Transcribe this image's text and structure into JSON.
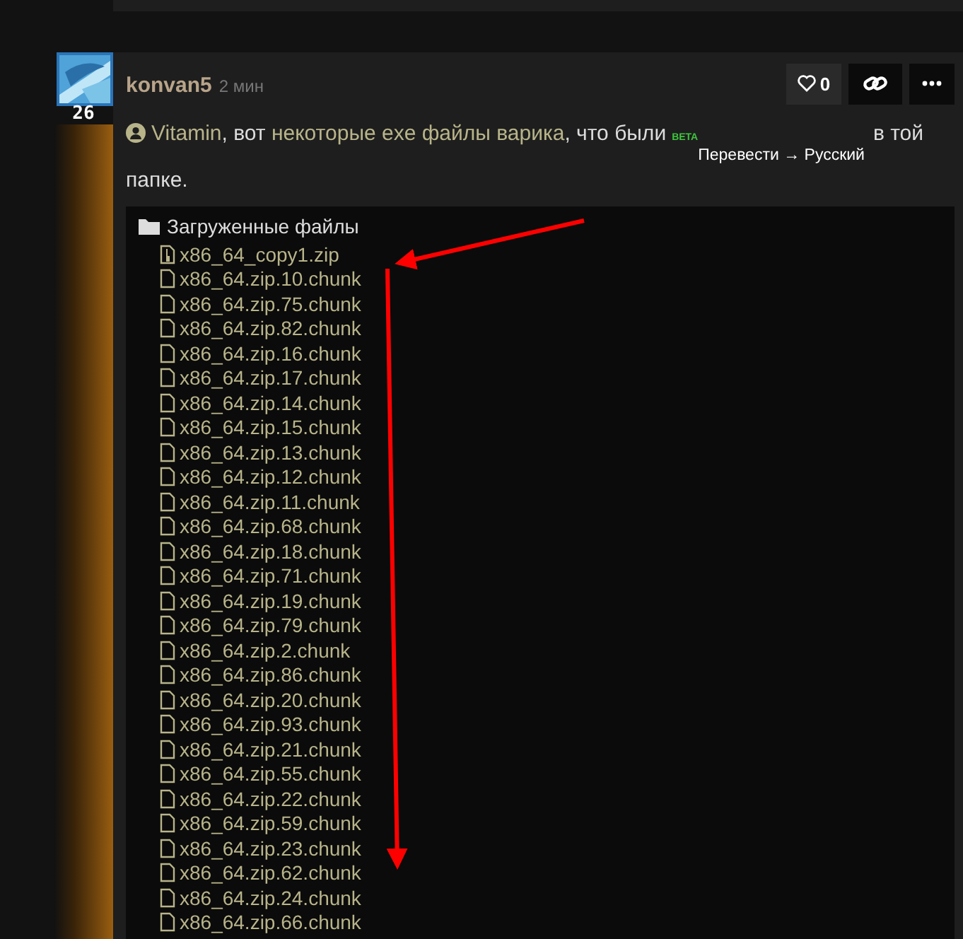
{
  "post": {
    "username": "konvan5",
    "time": "2 мин",
    "post_count": "26",
    "actions": [
      {
        "kind": "like",
        "label": "0"
      },
      {
        "kind": "link"
      },
      {
        "kind": "more"
      }
    ],
    "message": [
      {
        "kind": "mention",
        "text": "Vitamin"
      },
      {
        "kind": "text",
        "text": ", вот "
      },
      {
        "kind": "link",
        "text": "некоторые exe файлы варика"
      },
      {
        "kind": "text",
        "text": ", что были"
      },
      {
        "kind": "translate",
        "badge": "BETA",
        "text": "Перевести → Русский"
      },
      {
        "kind": "text",
        "text": "в той папке."
      }
    ],
    "attachments": {
      "title": "Загруженные файлы",
      "files": [
        {
          "kind": "zip",
          "name": "x86_64_copy1.zip"
        },
        {
          "kind": "file",
          "name": "x86_64.zip.10.chunk"
        },
        {
          "kind": "file",
          "name": "x86_64.zip.75.chunk"
        },
        {
          "kind": "file",
          "name": "x86_64.zip.82.chunk"
        },
        {
          "kind": "file",
          "name": "x86_64.zip.16.chunk"
        },
        {
          "kind": "file",
          "name": "x86_64.zip.17.chunk"
        },
        {
          "kind": "file",
          "name": "x86_64.zip.14.chunk"
        },
        {
          "kind": "file",
          "name": "x86_64.zip.15.chunk"
        },
        {
          "kind": "file",
          "name": "x86_64.zip.13.chunk"
        },
        {
          "kind": "file",
          "name": "x86_64.zip.12.chunk"
        },
        {
          "kind": "file",
          "name": "x86_64.zip.11.chunk"
        },
        {
          "kind": "file",
          "name": "x86_64.zip.68.chunk"
        },
        {
          "kind": "file",
          "name": "x86_64.zip.18.chunk"
        },
        {
          "kind": "file",
          "name": "x86_64.zip.71.chunk"
        },
        {
          "kind": "file",
          "name": "x86_64.zip.19.chunk"
        },
        {
          "kind": "file",
          "name": "x86_64.zip.79.chunk"
        },
        {
          "kind": "file",
          "name": "x86_64.zip.2.chunk"
        },
        {
          "kind": "file",
          "name": "x86_64.zip.86.chunk"
        },
        {
          "kind": "file",
          "name": "x86_64.zip.20.chunk"
        },
        {
          "kind": "file",
          "name": "x86_64.zip.93.chunk"
        },
        {
          "kind": "file",
          "name": "x86_64.zip.21.chunk"
        },
        {
          "kind": "file",
          "name": "x86_64.zip.55.chunk"
        },
        {
          "kind": "file",
          "name": "x86_64.zip.22.chunk"
        },
        {
          "kind": "file",
          "name": "x86_64.zip.59.chunk"
        },
        {
          "kind": "file",
          "name": "x86_64.zip.23.chunk"
        },
        {
          "kind": "file",
          "name": "x86_64.zip.62.chunk"
        },
        {
          "kind": "file",
          "name": "x86_64.zip.24.chunk"
        },
        {
          "kind": "file",
          "name": "x86_64.zip.66.chunk"
        }
      ]
    }
  }
}
